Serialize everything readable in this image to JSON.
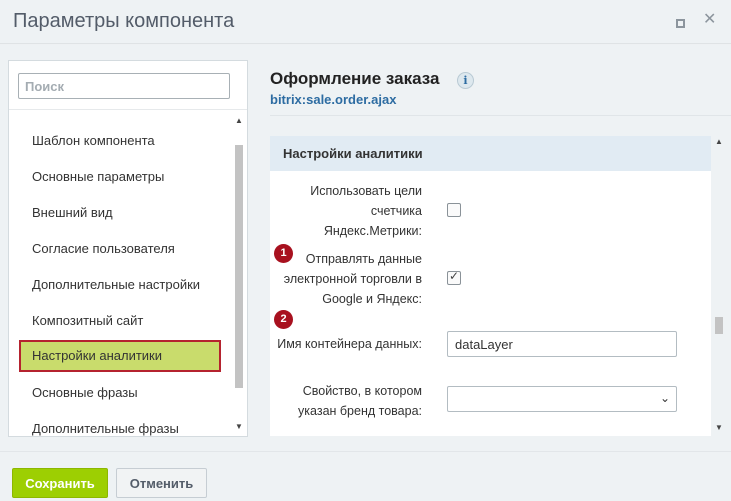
{
  "window": {
    "title": "Параметры компонента"
  },
  "left_panel": {
    "search_placeholder": "Поиск",
    "items": [
      {
        "label": "Шаблон компонента"
      },
      {
        "label": "Основные параметры"
      },
      {
        "label": "Внешний вид"
      },
      {
        "label": "Согласие пользователя"
      },
      {
        "label": "Дополнительные настройки"
      },
      {
        "label": "Композитный сайт"
      },
      {
        "label": "Настройки аналитики",
        "active": true
      },
      {
        "label": "Основные фразы"
      },
      {
        "label": "Дополнительные фразы"
      }
    ]
  },
  "component": {
    "title": "Оформление заказа",
    "code": "bitrix:sale.order.ajax",
    "info_glyph": "i"
  },
  "section": {
    "title": "Настройки аналитики",
    "fields": [
      {
        "label_lines": [
          "Использовать цели",
          "счетчика",
          "Яндекс.Метрики:"
        ],
        "type": "checkbox",
        "checked": false
      },
      {
        "badge": "1",
        "label_lines": [
          "Отправлять данные",
          "электронной торговли в",
          "Google и Яндекс:"
        ],
        "type": "checkbox",
        "checked": true
      },
      {
        "badge": "2",
        "label_lines": [
          "Имя контейнера данных:"
        ],
        "type": "text",
        "value": "dataLayer"
      },
      {
        "label_lines": [
          "Свойство, в котором",
          "указан бренд товара:"
        ],
        "type": "select",
        "value": ""
      }
    ]
  },
  "footer": {
    "save_label": "Сохранить",
    "cancel_label": "Отменить"
  },
  "colors": {
    "accent_green": "#9dcf02",
    "active_item_bg": "#c9dc6c",
    "highlight_border": "#b5232f",
    "badge": "#a8111f",
    "link_blue": "#2d6ca2"
  },
  "icons": [
    "maximize-icon",
    "close-icon",
    "info-icon",
    "checkmark-icon",
    "chevron-down-icon",
    "scroll-up-arrow",
    "scroll-down-arrow"
  ]
}
